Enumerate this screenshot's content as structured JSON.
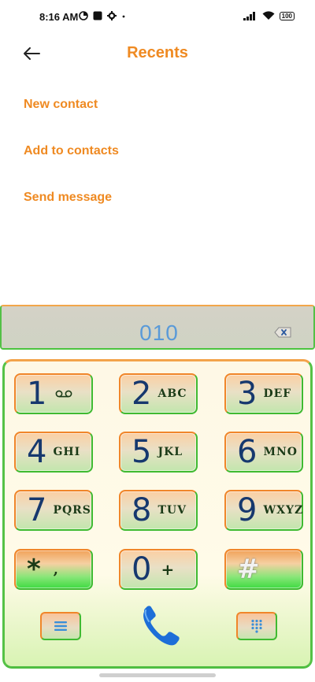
{
  "status_bar": {
    "time": "8:16 AM",
    "battery": "100"
  },
  "header": {
    "title": "Recents"
  },
  "actions": [
    {
      "label": "New contact"
    },
    {
      "label": "Add to contacts"
    },
    {
      "label": "Send message"
    }
  ],
  "dialer": {
    "number": "010",
    "keys": [
      {
        "digit": "1",
        "letters": ""
      },
      {
        "digit": "2",
        "letters": "ABC"
      },
      {
        "digit": "3",
        "letters": "DEF"
      },
      {
        "digit": "4",
        "letters": "GHI"
      },
      {
        "digit": "5",
        "letters": "JKL"
      },
      {
        "digit": "6",
        "letters": "MNO"
      },
      {
        "digit": "7",
        "letters": "PQRS"
      },
      {
        "digit": "8",
        "letters": "TUV"
      },
      {
        "digit": "9",
        "letters": "WXYZ"
      },
      {
        "digit": "*",
        "letters": ","
      },
      {
        "digit": "0",
        "letters": "+"
      },
      {
        "digit": "#",
        "letters": ""
      }
    ]
  },
  "colors": {
    "accent": "#ef8a22",
    "number": "#5a9ad8",
    "call": "#1d6ed8"
  }
}
